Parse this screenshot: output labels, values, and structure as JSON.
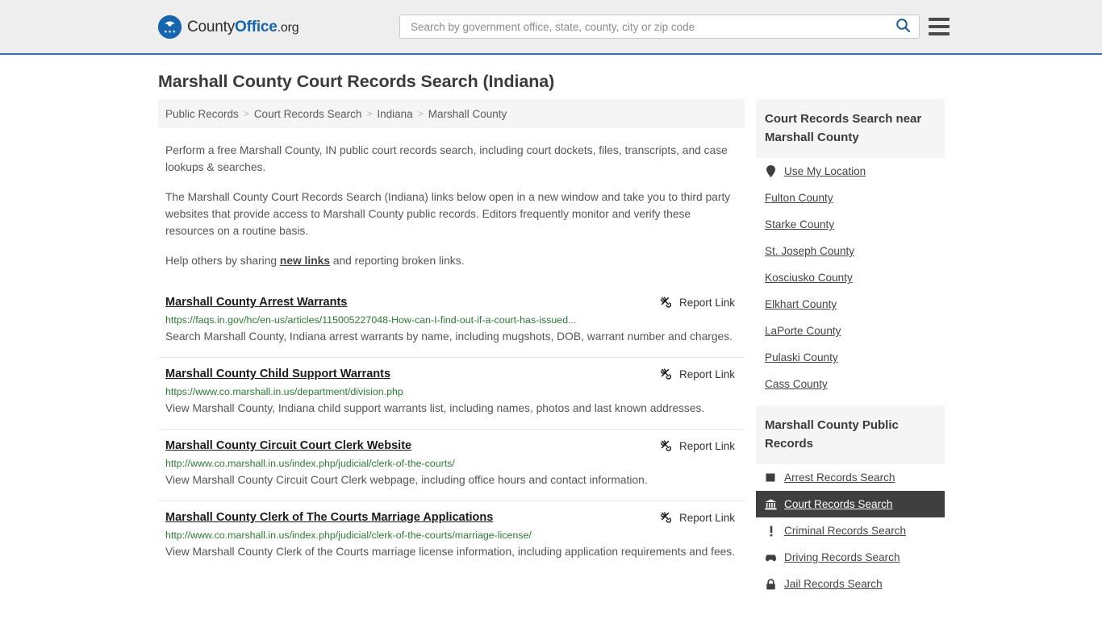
{
  "header": {
    "logo": {
      "icon": "eagle-seal-icon",
      "text_part1": "County",
      "text_part2": "Office",
      "text_part3": ".org"
    },
    "search": {
      "placeholder": "Search by government office, state, county, city or zip code",
      "value": "",
      "button_icon": "search-icon"
    },
    "menu_icon": "hamburger-menu-icon",
    "background_color": "#eeeeee",
    "accent_color": "#3a6ea5"
  },
  "page_title": "Marshall County Court Records Search (Indiana)",
  "breadcrumb": {
    "items": [
      {
        "label": "Public Records"
      },
      {
        "label": "Court Records Search"
      },
      {
        "label": "Indiana"
      },
      {
        "label": "Marshall County"
      }
    ],
    "separator": ">"
  },
  "intro": {
    "paragraph1": "Perform a free Marshall County, IN public court records search, including court dockets, files, transcripts, and case lookups & searches.",
    "paragraph2": "The Marshall County Court Records Search (Indiana) links below open in a new window and take you to third party websites that provide access to Marshall County public records. Editors frequently monitor and verify these resources on a routine basis.",
    "paragraph3_before": "Help others by sharing ",
    "paragraph3_link": "new links",
    "paragraph3_after": " and reporting broken links."
  },
  "report_link_label": "Report Link",
  "report_link_icon": "broken-link-icon",
  "results": [
    {
      "title": "Marshall County Arrest Warrants",
      "url": "https://faqs.in.gov/hc/en-us/articles/115005227048-How-can-I-find-out-if-a-court-has-issued...",
      "description": "Search Marshall County, Indiana arrest warrants by name, including mugshots, DOB, warrant number and charges."
    },
    {
      "title": "Marshall County Child Support Warrants",
      "url": "https://www.co.marshall.in.us/department/division.php",
      "description": "View Marshall County, Indiana child support warrants list, including names, photos and last known addresses."
    },
    {
      "title": "Marshall County Circuit Court Clerk Website",
      "url": "http://www.co.marshall.in.us/index.php/judicial/clerk-of-the-courts/",
      "description": "View Marshall County Circuit Court Clerk webpage, including office hours and contact information."
    },
    {
      "title": "Marshall County Clerk of The Courts Marriage Applications",
      "url": "http://www.co.marshall.in.us/index.php/judicial/clerk-of-the-courts/marriage-license/",
      "description": "View Marshall County Clerk of the Courts marriage license information, including application requirements and fees."
    }
  ],
  "sidebar": {
    "nearby": {
      "heading": "Court Records Search near Marshall County",
      "items": [
        {
          "label": "Use My Location",
          "icon": "map-pin-icon",
          "has_icon": true
        },
        {
          "label": "Fulton County",
          "icon": "",
          "has_icon": false
        },
        {
          "label": "Starke County",
          "icon": "",
          "has_icon": false
        },
        {
          "label": "St. Joseph County",
          "icon": "",
          "has_icon": false
        },
        {
          "label": "Kosciusko County",
          "icon": "",
          "has_icon": false
        },
        {
          "label": "Elkhart County",
          "icon": "",
          "has_icon": false
        },
        {
          "label": "LaPorte County",
          "icon": "",
          "has_icon": false
        },
        {
          "label": "Pulaski County",
          "icon": "",
          "has_icon": false
        },
        {
          "label": "Cass County",
          "icon": "",
          "has_icon": false
        }
      ]
    },
    "public_records": {
      "heading": "Marshall County Public Records",
      "active_item": "Court Records Search",
      "active_background": "#3f3f3f",
      "items": [
        {
          "label": "Arrest Records Search",
          "icon": "square-icon",
          "active": false
        },
        {
          "label": "Court Records Search",
          "icon": "courthouse-icon",
          "active": true
        },
        {
          "label": "Criminal Records Search",
          "icon": "exclamation-icon",
          "active": false
        },
        {
          "label": "Driving Records Search",
          "icon": "car-icon",
          "active": false
        },
        {
          "label": "Jail Records Search",
          "icon": "lock-icon",
          "active": false
        }
      ]
    }
  }
}
